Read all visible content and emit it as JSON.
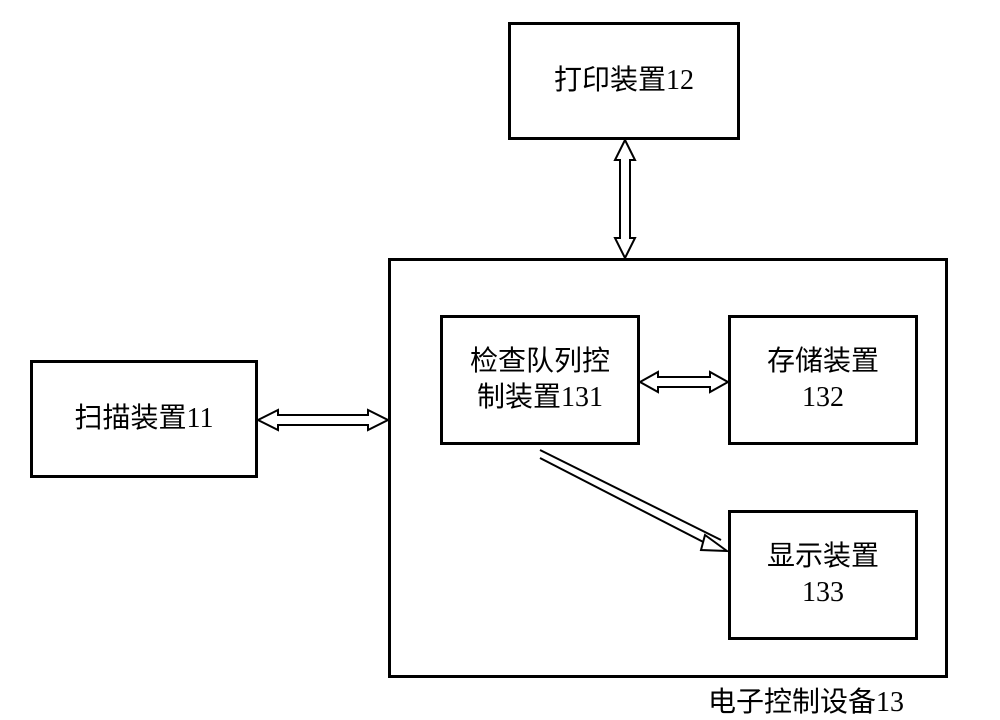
{
  "boxes": {
    "scanner": "扫描装置11",
    "printer": "打印装置12",
    "queueControl": "检查队列控\n制装置131",
    "storage": "存储装置\n132",
    "display": "显示装置\n133",
    "electronicControl": "电子控制设备13"
  }
}
